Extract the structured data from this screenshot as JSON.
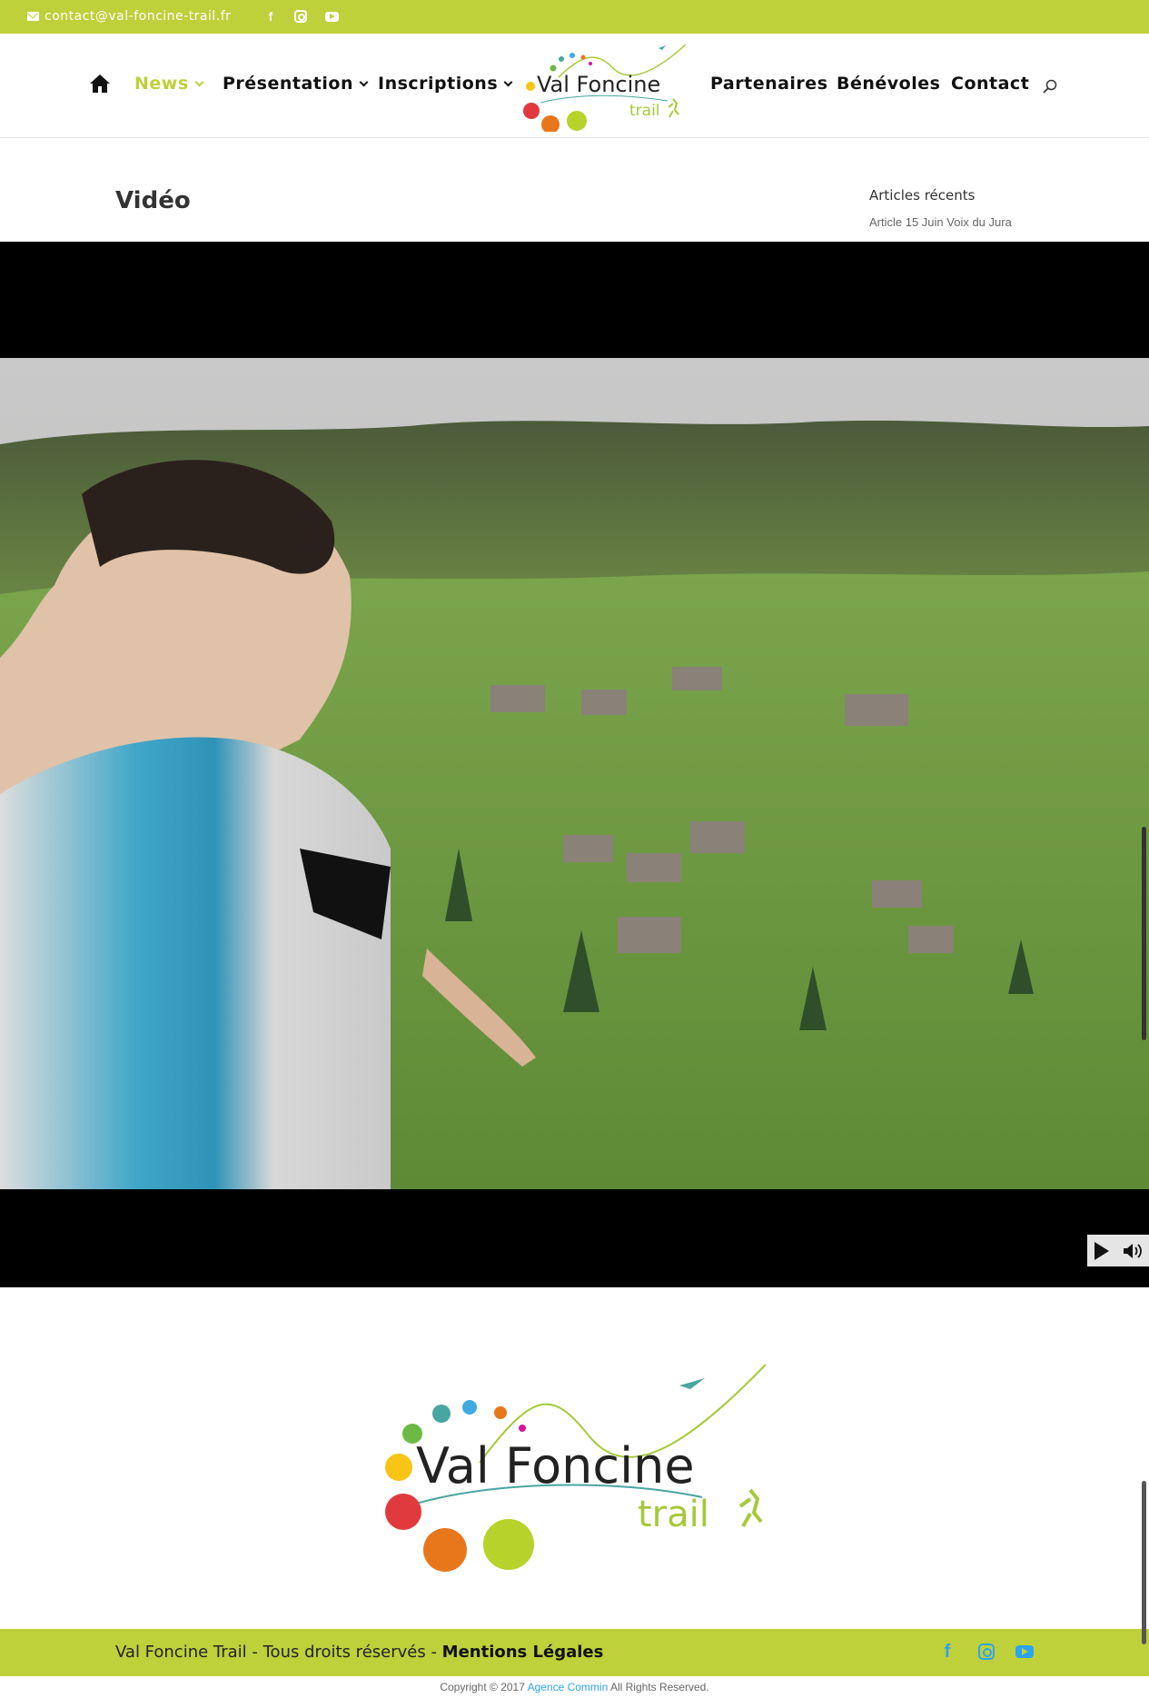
{
  "topbar": {
    "email": "contact@val-foncine-trail.fr",
    "social": [
      "facebook-icon",
      "instagram-icon",
      "youtube-icon"
    ],
    "color": "#bed03a"
  },
  "nav": {
    "items": [
      {
        "label": "News",
        "active": true,
        "has_dropdown": true
      },
      {
        "label": "Présentation",
        "active": false,
        "has_dropdown": true
      },
      {
        "label": "Inscriptions",
        "active": false,
        "has_dropdown": true
      },
      {
        "label": "Partenaires",
        "active": false,
        "has_dropdown": false
      },
      {
        "label": "Bénévoles",
        "active": false,
        "has_dropdown": false
      },
      {
        "label": "Contact",
        "active": false,
        "has_dropdown": false
      }
    ],
    "accent_color": "#bed03a"
  },
  "logo": {
    "line1": "Val Foncine",
    "line2": "trail"
  },
  "main": {
    "title": "Vidéo"
  },
  "sidebar": {
    "title": "Articles récents",
    "links": [
      "Article 15 Juin Voix du Jura"
    ]
  },
  "video": {
    "controls": [
      "play-icon",
      "volume-icon"
    ]
  },
  "footer": {
    "rights": "Val Foncine Trail - Tous droits réservés - ",
    "legal": "Mentions Légales",
    "copyright_prefix": "Copyright © 2017 ",
    "agency": "Agence Commin",
    "copyright_suffix": " All Rights Reserved.",
    "link_color": "#2ea3f2"
  }
}
